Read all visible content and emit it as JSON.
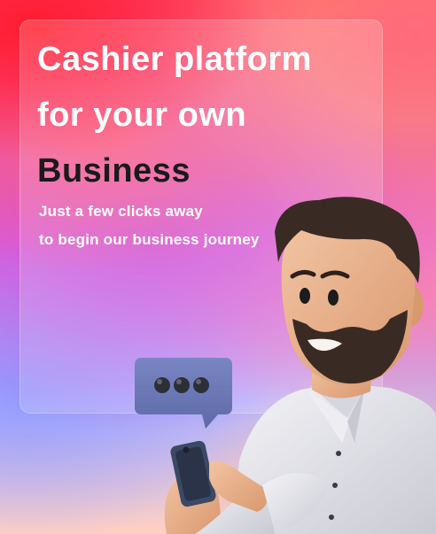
{
  "hero": {
    "headline_line1": "Cashier platform",
    "headline_line2": "for your own",
    "headline_line3": "Business",
    "subtitle_line1": "Just a few clicks away",
    "subtitle_line2": "to begin our business journey"
  },
  "illustration": {
    "character": "man-with-phone",
    "chat_bubble_icon": "typing-dots-icon"
  },
  "colors": {
    "headline_white": "#ffffff",
    "headline_dark": "#1a1a1a",
    "bubble": "#6b78b8",
    "shirt": "#e4e5ea",
    "skin": "#e9b592",
    "hair": "#3a2a24",
    "phone": "#3b4a64"
  }
}
